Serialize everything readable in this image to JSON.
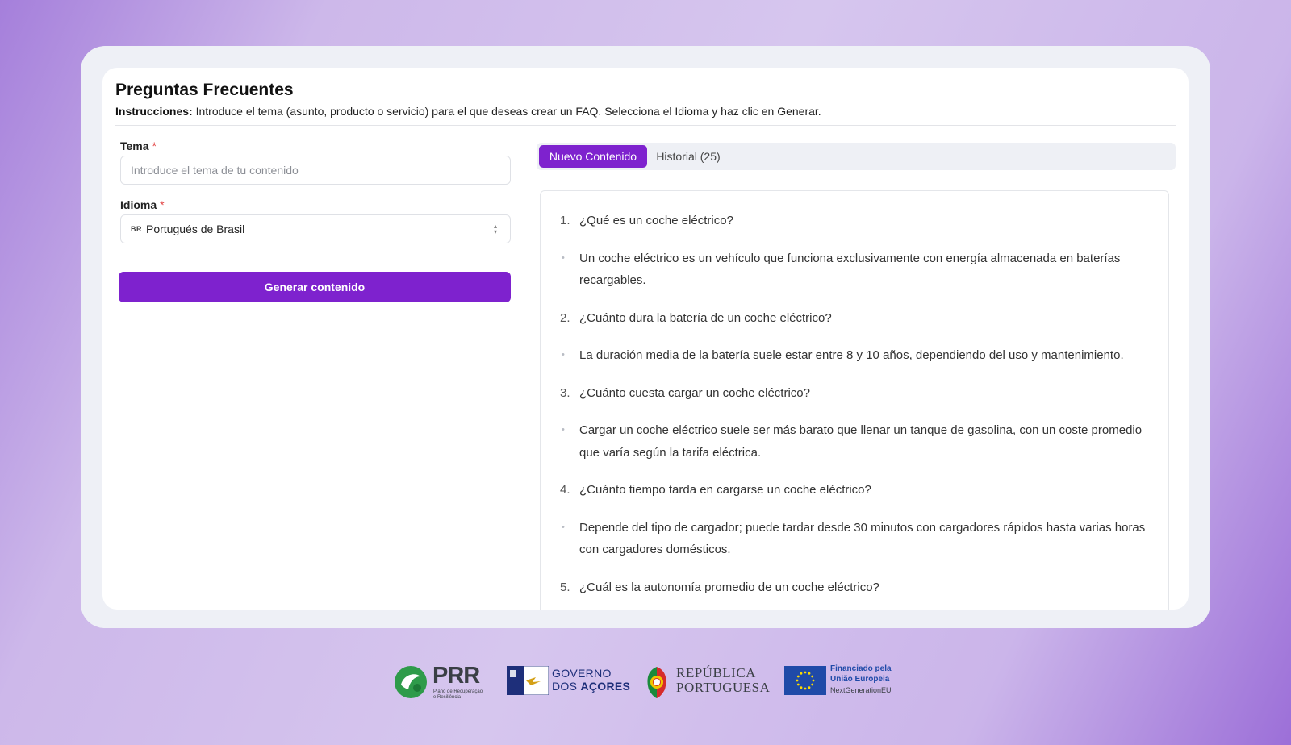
{
  "page": {
    "title": "Preguntas Frecuentes",
    "instructions_label": "Instrucciones:",
    "instructions_text": " Introduce el tema (asunto, producto o servicio) para el que deseas crear un FAQ. Selecciona el Idioma y haz clic en Generar."
  },
  "form": {
    "tema_label": "Tema",
    "tema_required": "*",
    "tema_placeholder": "Introduce el tema de tu contenido",
    "tema_value": "",
    "idioma_label": "Idioma",
    "idioma_required": "*",
    "idioma_flag": "BR",
    "idioma_value": "Portugués de Brasil",
    "generate_label": "Generar contenido"
  },
  "tabs": [
    {
      "label": "Nuevo Contenido",
      "active": true
    },
    {
      "label": "Historial (25)",
      "active": false
    }
  ],
  "faq": [
    {
      "marker": "1.",
      "text": "¿Qué es un coche eléctrico?"
    },
    {
      "marker": "•",
      "text": "Un coche eléctrico es un vehículo que funciona exclusivamente con energía almacenada en baterías recargables."
    },
    {
      "marker": "2.",
      "text": "¿Cuánto dura la batería de un coche eléctrico?"
    },
    {
      "marker": "•",
      "text": "La duración media de la batería suele estar entre 8 y 10 años, dependiendo del uso y mantenimiento."
    },
    {
      "marker": "3.",
      "text": "¿Cuánto cuesta cargar un coche eléctrico?"
    },
    {
      "marker": "•",
      "text": "Cargar un coche eléctrico suele ser más barato que llenar un tanque de gasolina, con un coste promedio que varía según la tarifa eléctrica."
    },
    {
      "marker": "4.",
      "text": "¿Cuánto tiempo tarda en cargarse un coche eléctrico?"
    },
    {
      "marker": "•",
      "text": "Depende del tipo de cargador; puede tardar desde 30 minutos con cargadores rápidos hasta varias horas con cargadores domésticos."
    },
    {
      "marker": "5.",
      "text": "¿Cuál es la autonomía promedio de un coche eléctrico?"
    }
  ],
  "footer": {
    "prr": {
      "name": "PRR",
      "sub1": "Plano de Recuperação",
      "sub2": "e Resiliência"
    },
    "azores": {
      "line1": "GOVERNO",
      "line2_a": "DOS ",
      "line2_b": "AÇORES"
    },
    "portugal": {
      "line1": "REPÚBLICA",
      "line2": "PORTUGUESA"
    },
    "eu": {
      "line1": "Financiado pela",
      "line2": "União Europeia",
      "line3": "NextGenerationEU"
    }
  },
  "colors": {
    "accent": "#7e22ce",
    "required": "#e24444",
    "prr_green": "#2e9b4a",
    "eu_blue": "#1f4aa8",
    "eu_yellow": "#ffdd00"
  }
}
